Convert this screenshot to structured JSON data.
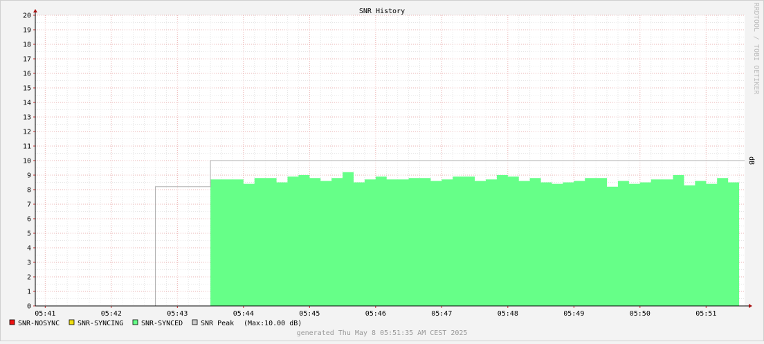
{
  "chart_data": {
    "type": "area",
    "title": "SNR History",
    "watermark": "RRDTOOL / TOBI OETIKER",
    "ylabel": "dB",
    "xlabel": "",
    "ylim": [
      0,
      20
    ],
    "y_ticks": [
      0,
      1,
      2,
      3,
      4,
      5,
      6,
      7,
      8,
      9,
      10,
      11,
      12,
      13,
      14,
      15,
      16,
      17,
      18,
      19,
      20
    ],
    "x_range_minutes": [
      "05:40:51",
      "05:51:35"
    ],
    "x_ticks": [
      "05:41",
      "05:42",
      "05:43",
      "05:44",
      "05:45",
      "05:46",
      "05:47",
      "05:48",
      "05:49",
      "05:50",
      "05:51"
    ],
    "grid": true,
    "legend_position": "bottom-left",
    "legend": [
      {
        "label": "SNR-NOSYNC",
        "color": "#ee1111"
      },
      {
        "label": "SNR-SYNCING",
        "color": "#eedd11"
      },
      {
        "label": "SNR-SYNCED",
        "color": "#66ff88"
      },
      {
        "label": "SNR Peak",
        "color": "#cccccc"
      }
    ],
    "legend_extra": "(Max:10.00 dB)",
    "footer": "generated Thu May  8 05:51:35 AM CEST 2025",
    "synced_series": {
      "name": "SNR-SYNCED",
      "color": "#66ff88",
      "start": "05:43:30",
      "step_seconds": 10,
      "values": [
        8.7,
        8.7,
        8.7,
        8.4,
        8.8,
        8.8,
        8.5,
        8.9,
        9.0,
        8.8,
        8.6,
        8.8,
        9.2,
        8.5,
        8.7,
        8.9,
        8.7,
        8.7,
        8.8,
        8.8,
        8.6,
        8.7,
        8.9,
        8.9,
        8.6,
        8.7,
        9.0,
        8.9,
        8.6,
        8.8,
        8.5,
        8.4,
        8.5,
        8.6,
        8.8,
        8.8,
        8.2,
        8.6,
        8.4,
        8.5,
        8.7,
        8.7,
        9.0,
        8.3,
        8.6,
        8.4,
        8.8,
        8.5
      ]
    },
    "peak_series": {
      "name": "SNR Peak",
      "color": "#b0b0b0",
      "points": [
        {
          "x": "05:42:40",
          "y": 8.2
        },
        {
          "x": "05:43:30",
          "y": 10.0
        },
        {
          "x": "05:51:35",
          "y": 10.0
        }
      ]
    }
  }
}
